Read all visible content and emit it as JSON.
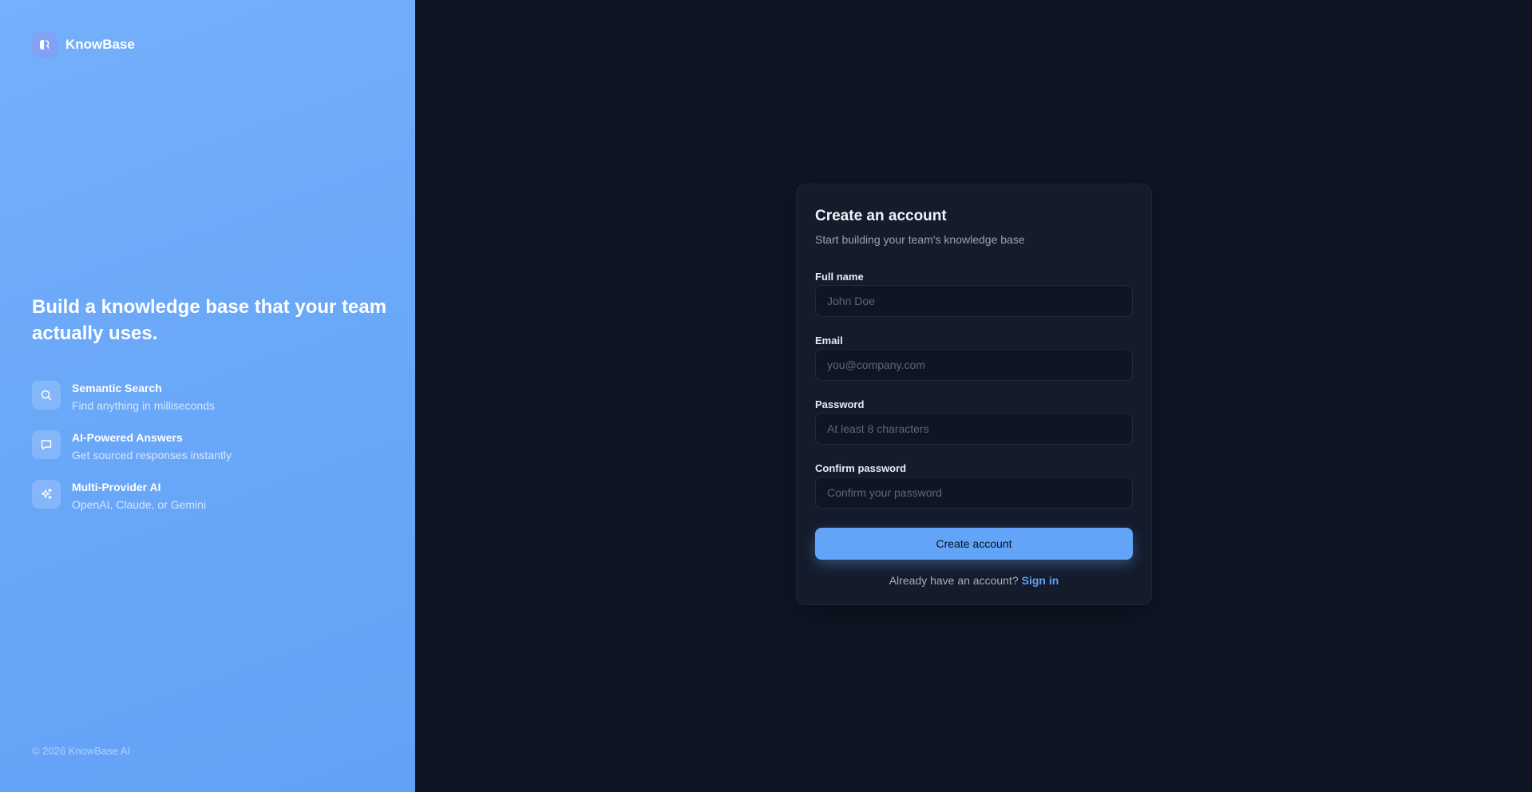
{
  "brand": {
    "name": "KnowBase",
    "logo_icon": "brain-icon"
  },
  "hero": {
    "headline": "Build a knowledge base that your team actually uses."
  },
  "features": [
    {
      "icon": "search-icon",
      "title": "Semantic Search",
      "description": "Find anything in milliseconds"
    },
    {
      "icon": "chat-icon",
      "title": "AI-Powered Answers",
      "description": "Get sourced responses instantly"
    },
    {
      "icon": "sparkles-icon",
      "title": "Multi-Provider AI",
      "description": "OpenAI, Claude, or Gemini"
    }
  ],
  "footer": {
    "copyright": "© 2026 KnowBase AI"
  },
  "form": {
    "title": "Create an account",
    "subtitle": "Start building your team's knowledge base",
    "full_name": {
      "label": "Full name",
      "placeholder": "John Doe",
      "value": ""
    },
    "email": {
      "label": "Email",
      "placeholder": "you@company.com",
      "value": ""
    },
    "password": {
      "label": "Password",
      "placeholder": "At least 8 characters",
      "value": ""
    },
    "confirm_password": {
      "label": "Confirm password",
      "placeholder": "Confirm your password",
      "value": ""
    },
    "submit_label": "Create account",
    "signin_prompt": "Already have an account?",
    "signin_link": "Sign in"
  },
  "colors": {
    "left_panel": "#6aa8f8",
    "page_background": "#0f1524",
    "card_background": "#141b2b",
    "accent": "#62a4f7",
    "link": "#5fa1f6"
  }
}
